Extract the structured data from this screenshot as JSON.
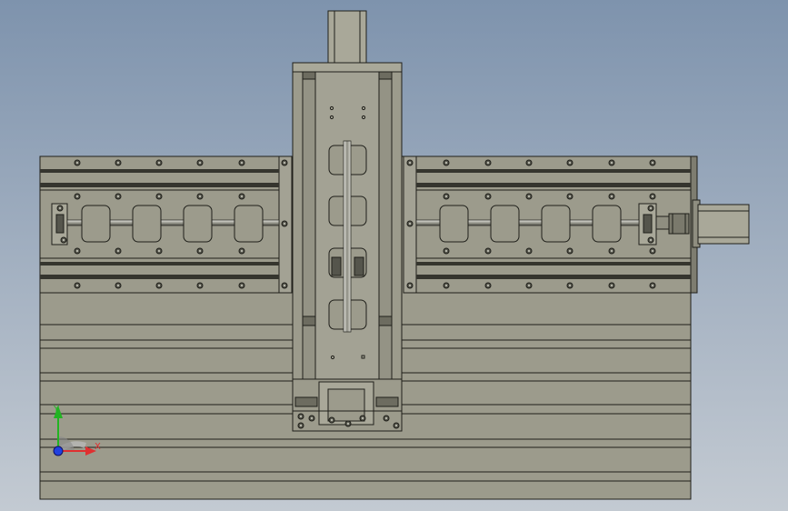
{
  "viewport": {
    "background_top": "#7e93ad",
    "background_bottom": "#c3cad2"
  },
  "colors": {
    "part_fill": "#9c9b8c",
    "part_fill_light": "#a9a899",
    "part_fill_dark": "#6d6c60",
    "outline": "#1f1f1a",
    "screw_fill": "#56564c",
    "rod_fill": "#c9c9c0",
    "axis_x": "#e03030",
    "axis_y": "#22b422",
    "axis_z": "#2040e0"
  },
  "triad": {
    "x_label": "X",
    "y_label": "Y"
  }
}
